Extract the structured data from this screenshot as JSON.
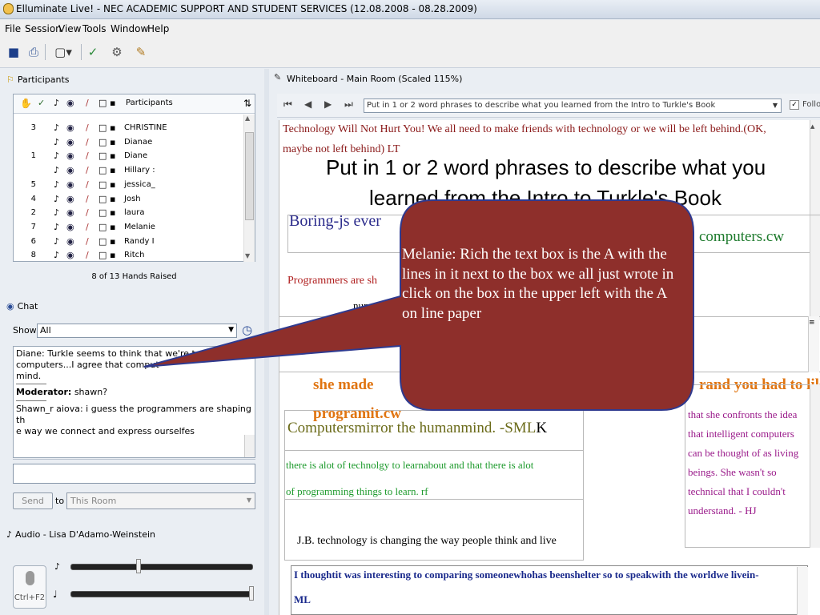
{
  "window": {
    "title": "Elluminate Live! - NEC ACADEMIC SUPPORT AND STUDENT SERVICES (12.08.2008 - 08.28.2009)"
  },
  "menu": [
    "File",
    "Session",
    "View",
    "Tools",
    "Window",
    "Help"
  ],
  "participants": {
    "header": "Participants",
    "column_label": "Participants",
    "rows": [
      {
        "num": "3",
        "name": "CHRISTINE"
      },
      {
        "num": "",
        "name": "Dianae"
      },
      {
        "num": "1",
        "name": "Diane"
      },
      {
        "num": "",
        "name": "Hillary :"
      },
      {
        "num": "5",
        "name": "jessica_"
      },
      {
        "num": "4",
        "name": "Josh"
      },
      {
        "num": "2",
        "name": "laura"
      },
      {
        "num": "7",
        "name": "Melanie"
      },
      {
        "num": "6",
        "name": "Randy I"
      },
      {
        "num": "8",
        "name": "Ritch"
      }
    ],
    "hands_raised": "8 of 13 Hands Raised"
  },
  "chat": {
    "header": "Chat",
    "show_label": "Show",
    "show_value": "All",
    "msg1": "Diane: Turkle seems to think that we're too lead b",
    "msg1_cont": "computers...I agree that comput",
    "msg1_end": "mind.",
    "mod_label": "Moderator:",
    "mod_text": " shawn?",
    "msg3": "Shawn_r aiova: i guess the programmers are shaping th",
    "msg3_cont": "e way we connect and express ourselfes",
    "send_label": "Send",
    "to_label": "to",
    "to_value": "This Room"
  },
  "audio": {
    "header": "Audio - Lisa D'Adamo-Weinstein",
    "shortcut": "Ctrl+F2"
  },
  "whiteboard": {
    "header": "Whiteboard - Main Room (Scaled 115%)",
    "screen_title": "Put in 1 or 2 word phrases to describe what you learned from the Intro to Turkle's Book",
    "follow": "Follo",
    "lt_line1": "Technology  Will Not Hurt You!  We all need to make friends  with technology  or we will be left behind.(OK,",
    "lt_line2": "maybe  not left  behind)  LT",
    "heading_line1": "Put in 1 or 2 word phrases to describe what you",
    "heading_line2": "learned from the Intro to Turkle's Book",
    "boring": "Boring-js ever",
    "computers_cw": "computers.cw",
    "programmers": "Programmers are sh",
    "numer": "numer",
    "she_made": "she made",
    "brand": "rand you had to lik",
    "programit": "programit.cw",
    "sml_a": "Computersmirror the humanmind. -SML",
    "sml_b": "K",
    "rf_line1": "there  is alot of technolgy  to learnabout   and that there is alot",
    "rf_line2": "of programming   things  to learn.  rf",
    "hj": [
      "that  she  confronts   the  idea",
      "that  intelligent   computers",
      "can  be thought   of  as living",
      "beings.  She  wasn't   so",
      "technical   that  I couldn't",
      "understand.   - HJ"
    ],
    "jb": "J.B. technology is changing the way people think and live",
    "ml_line1": "I thoughtit was interesting to comparing someonewhohas  beenshelter so to speakwith the worldwe livein-",
    "ml_line2": "ML"
  },
  "callout": {
    "text": "Melanie: Rich the text box is the A with the lines in it next to the box we all just wrote in click on the box in the upper left with the A on line paper",
    "fill": "#8e2f2b",
    "border": "#2f3a8f"
  }
}
